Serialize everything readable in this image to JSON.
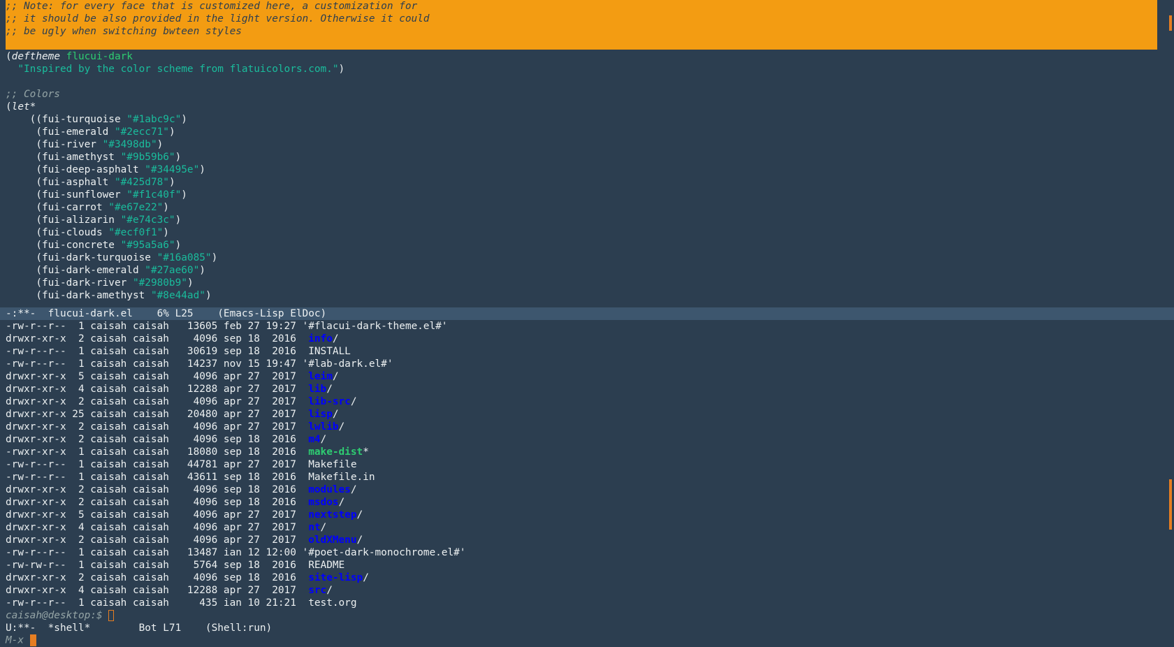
{
  "code": {
    "comment_lines": [
      ";; Note: for every face that is customized here, a customization for",
      ";; it should be also provided in the light version. Otherwise it could",
      ";; be ugly when switching bwteen styles"
    ],
    "deftheme_kw": "deftheme",
    "theme_name": "flucui-dark",
    "docstring": "\"Inspired by the color scheme from flatuicolors.com.\"",
    "colors_comment": ";; Colors",
    "let_kw": "let*",
    "colors": [
      {
        "name": "fui-turquoise",
        "value": "\"#1abc9c\""
      },
      {
        "name": "fui-emerald",
        "value": "\"#2ecc71\""
      },
      {
        "name": "fui-river",
        "value": "\"#3498db\""
      },
      {
        "name": "fui-amethyst",
        "value": "\"#9b59b6\""
      },
      {
        "name": "fui-deep-asphalt",
        "value": "\"#34495e\""
      },
      {
        "name": "fui-asphalt",
        "value": "\"#425d78\""
      },
      {
        "name": "fui-sunflower",
        "value": "\"#f1c40f\""
      },
      {
        "name": "fui-carrot",
        "value": "\"#e67e22\""
      },
      {
        "name": "fui-alizarin",
        "value": "\"#e74c3c\""
      },
      {
        "name": "fui-clouds",
        "value": "\"#ecf0f1\""
      },
      {
        "name": "fui-concrete",
        "value": "\"#95a5a6\""
      },
      {
        "name": "fui-dark-turquoise",
        "value": "\"#16a085\""
      },
      {
        "name": "fui-dark-emerald",
        "value": "\"#27ae60\""
      },
      {
        "name": "fui-dark-river",
        "value": "\"#2980b9\""
      },
      {
        "name": "fui-dark-amethyst",
        "value": "\"#8e44ad\""
      }
    ]
  },
  "modeline_top": "-:**-  flucui-dark.el    6% L25    (Emacs-Lisp ElDoc)",
  "shell": {
    "rows": [
      {
        "meta": "-rw-r--r--  1 caisah caisah   13605 feb 27 19:27 ",
        "name": "'#flacui-dark-theme.el#'",
        "kind": "file",
        "suffix": ""
      },
      {
        "meta": "drwxr-xr-x  2 caisah caisah    4096 sep 18  2016  ",
        "name": "info",
        "kind": "dir",
        "suffix": "/"
      },
      {
        "meta": "-rw-r--r--  1 caisah caisah   30619 sep 18  2016  ",
        "name": "INSTALL",
        "kind": "file",
        "suffix": ""
      },
      {
        "meta": "-rw-r--r--  1 caisah caisah   14237 nov 15 19:47 ",
        "name": "'#lab-dark.el#'",
        "kind": "file",
        "suffix": ""
      },
      {
        "meta": "drwxr-xr-x  5 caisah caisah    4096 apr 27  2017  ",
        "name": "leim",
        "kind": "dir",
        "suffix": "/"
      },
      {
        "meta": "drwxr-xr-x  4 caisah caisah   12288 apr 27  2017  ",
        "name": "lib",
        "kind": "dir",
        "suffix": "/"
      },
      {
        "meta": "drwxr-xr-x  2 caisah caisah    4096 apr 27  2017  ",
        "name": "lib-src",
        "kind": "dir",
        "suffix": "/"
      },
      {
        "meta": "drwxr-xr-x 25 caisah caisah   20480 apr 27  2017  ",
        "name": "lisp",
        "kind": "dir",
        "suffix": "/"
      },
      {
        "meta": "drwxr-xr-x  2 caisah caisah    4096 apr 27  2017  ",
        "name": "lwlib",
        "kind": "dir",
        "suffix": "/"
      },
      {
        "meta": "drwxr-xr-x  2 caisah caisah    4096 sep 18  2016  ",
        "name": "m4",
        "kind": "dir",
        "suffix": "/"
      },
      {
        "meta": "-rwxr-xr-x  1 caisah caisah   18080 sep 18  2016  ",
        "name": "make-dist",
        "kind": "exe",
        "suffix": "*"
      },
      {
        "meta": "-rw-r--r--  1 caisah caisah   44781 apr 27  2017  ",
        "name": "Makefile",
        "kind": "file",
        "suffix": ""
      },
      {
        "meta": "-rw-r--r--  1 caisah caisah   43611 sep 18  2016  ",
        "name": "Makefile.in",
        "kind": "file",
        "suffix": ""
      },
      {
        "meta": "drwxr-xr-x  2 caisah caisah    4096 sep 18  2016  ",
        "name": "modules",
        "kind": "dir",
        "suffix": "/"
      },
      {
        "meta": "drwxr-xr-x  2 caisah caisah    4096 sep 18  2016  ",
        "name": "msdos",
        "kind": "dir",
        "suffix": "/"
      },
      {
        "meta": "drwxr-xr-x  5 caisah caisah    4096 apr 27  2017  ",
        "name": "nextstep",
        "kind": "dir",
        "suffix": "/"
      },
      {
        "meta": "drwxr-xr-x  4 caisah caisah    4096 apr 27  2017  ",
        "name": "nt",
        "kind": "dir",
        "suffix": "/"
      },
      {
        "meta": "drwxr-xr-x  2 caisah caisah    4096 apr 27  2017  ",
        "name": "oldXMenu",
        "kind": "dir",
        "suffix": "/"
      },
      {
        "meta": "-rw-r--r--  1 caisah caisah   13487 ian 12 12:00 ",
        "name": "'#poet-dark-monochrome.el#'",
        "kind": "file",
        "suffix": ""
      },
      {
        "meta": "-rw-rw-r--  1 caisah caisah    5764 sep 18  2016  ",
        "name": "README",
        "kind": "file",
        "suffix": ""
      },
      {
        "meta": "drwxr-xr-x  2 caisah caisah    4096 sep 18  2016  ",
        "name": "site-lisp",
        "kind": "dir",
        "suffix": "/"
      },
      {
        "meta": "drwxr-xr-x  4 caisah caisah   12288 apr 27  2017  ",
        "name": "src",
        "kind": "dir",
        "suffix": "/"
      },
      {
        "meta": "-rw-r--r--  1 caisah caisah     435 ian 10 21:21  ",
        "name": "test.org",
        "kind": "file",
        "suffix": ""
      }
    ],
    "prompt": "caisah@desktop:$ "
  },
  "modeline_bottom": "U:**-  *shell*        Bot L71    (Shell:run)",
  "minibuffer": "M-x ",
  "colors": {
    "background": "#2c3e50",
    "comment_highlight": "#f39c12",
    "modeline": "#3d566e",
    "cursor": "#e67e22",
    "dir": "#0000ff",
    "exe": "#2ecc71"
  }
}
